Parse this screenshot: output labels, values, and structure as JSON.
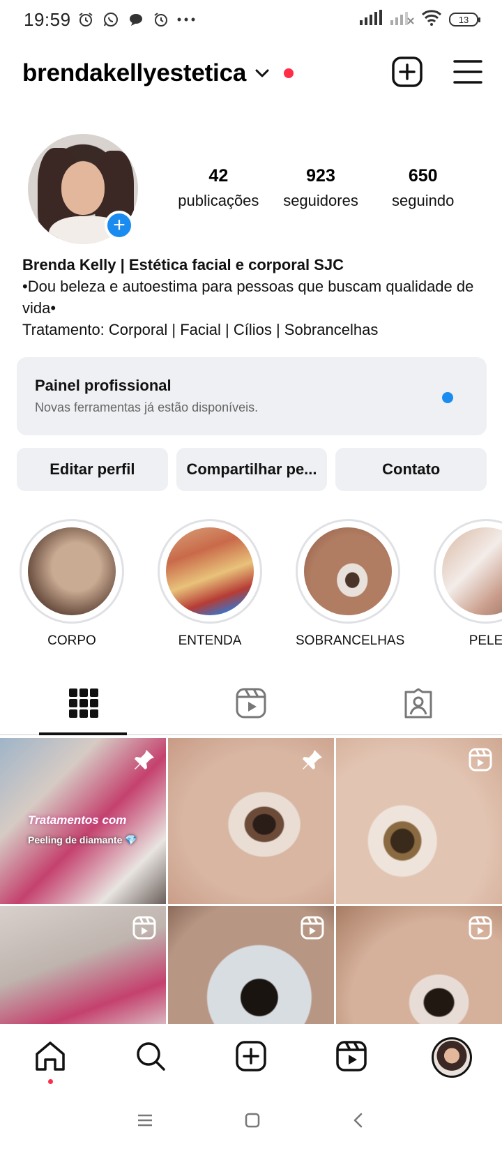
{
  "status_bar": {
    "time": "19:59",
    "battery": "13"
  },
  "header": {
    "username": "brendakellyestetica"
  },
  "profile": {
    "stats": [
      {
        "value": "42",
        "label": "publicações"
      },
      {
        "value": "923",
        "label": "seguidores"
      },
      {
        "value": "650",
        "label": "seguindo"
      }
    ],
    "bio_name": "Brenda Kelly | Estética facial e corporal SJC",
    "bio_line1": "•Dou beleza e autoestima para pessoas que buscam qualidade de vida•",
    "bio_line2": "Tratamento: Corporal | Facial | Cílios | Sobrancelhas"
  },
  "panel": {
    "title": "Painel profissional",
    "subtitle": "Novas ferramentas já estão disponíveis."
  },
  "buttons": {
    "edit": "Editar perfil",
    "share": "Compartilhar pe...",
    "contact": "Contato"
  },
  "highlights": [
    {
      "label": "CORPO"
    },
    {
      "label": "ENTENDA"
    },
    {
      "label": "SOBRANCELHAS"
    },
    {
      "label": "PELE"
    }
  ],
  "grid": {
    "post1_title": "Tratamentos com",
    "post1_subtitle": "Peeling de diamante 💎"
  },
  "colors": {
    "accent_blue": "#1a8cf0",
    "notification_red": "#ff2d45",
    "surface_gray": "#eff0f3"
  }
}
